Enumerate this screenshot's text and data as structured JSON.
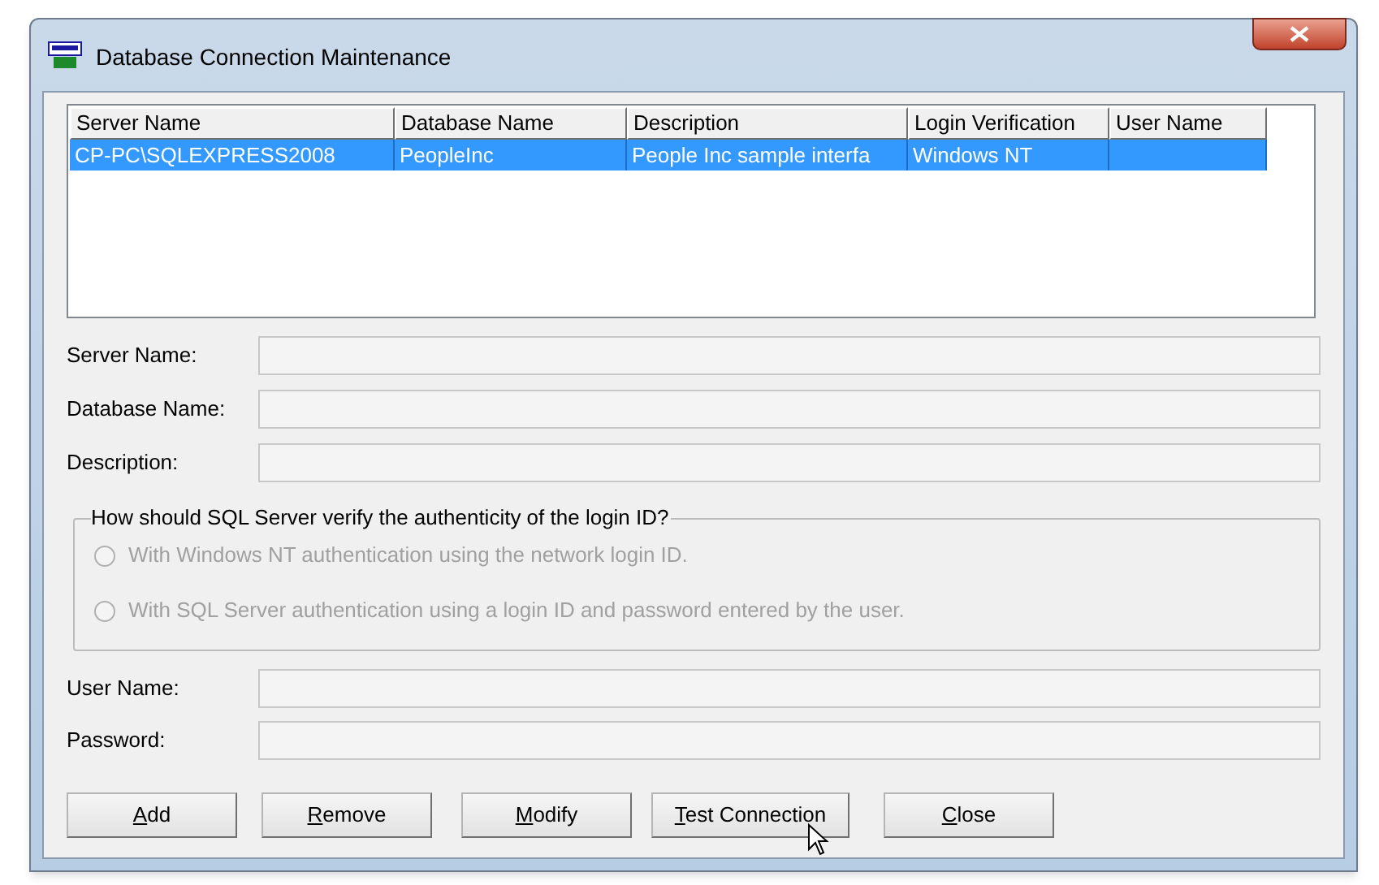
{
  "window": {
    "title": "Database Connection Maintenance"
  },
  "table": {
    "columns": [
      "Server Name",
      "Database Name",
      "Description",
      "Login Verification",
      "User Name"
    ],
    "rows": [
      {
        "selected": true,
        "cells": [
          "CP-PC\\SQLEXPRESS2008",
          "PeopleInc",
          "People Inc sample interfa",
          "Windows NT",
          null
        ]
      }
    ]
  },
  "fields_top": [
    {
      "label": "Server Name:"
    },
    {
      "label": "Database Name:"
    },
    {
      "label": "Description:"
    }
  ],
  "auth_group": {
    "title": "How should SQL Server verify the authenticity of the login ID?",
    "options": [
      {
        "label": "With Windows NT authentication using the network login ID.",
        "selected": false,
        "disabled": true
      },
      {
        "label": "With SQL Server authentication using a login ID and password entered by the user.",
        "selected": false,
        "disabled": true
      }
    ]
  },
  "fields_bottom": [
    {
      "label": "User Name:"
    },
    {
      "label": "Password:"
    }
  ],
  "buttons": [
    {
      "label": "Add",
      "underline_first": true
    },
    {
      "label": "Remove",
      "underline_first": true
    },
    {
      "label": "Modify",
      "underline_first": true
    },
    {
      "label": "Test Connection",
      "underline_first": true
    },
    {
      "label": "Close",
      "underline_first": true
    }
  ]
}
